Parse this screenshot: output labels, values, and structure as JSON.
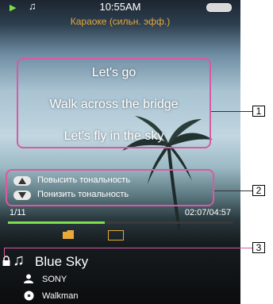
{
  "status": {
    "time": "10:55AM",
    "mode": "Караоке (сильн. эфф.)"
  },
  "lyrics": [
    "Let's go",
    "Walk across the bridge",
    "Let's fly in the sky"
  ],
  "key_controls": {
    "raise": "Повысить тональность",
    "lower": "Понизить тональность"
  },
  "track": {
    "number": "1/11",
    "time": "02:07/04:57",
    "progress": 0.43
  },
  "song": {
    "title": "Blue Sky",
    "artist": "SONY",
    "album": "Walkman"
  },
  "callouts": [
    "1",
    "2",
    "3"
  ],
  "colors": {
    "highlight": "#d75aa5",
    "accent": "#7de04a",
    "mode": "#e8a93a"
  },
  "icons": [
    "play-icon",
    "note-icon",
    "battery-icon",
    "folder-icon",
    "lyrics-icon",
    "lock-icon",
    "artist-icon",
    "album-icon"
  ]
}
